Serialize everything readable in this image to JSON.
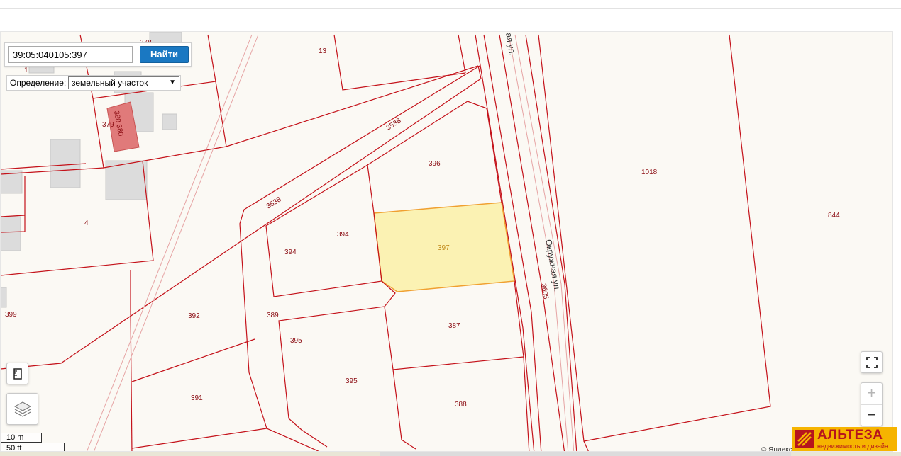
{
  "search": {
    "value": "39:05:040105:397",
    "button_label": "Найти"
  },
  "definition": {
    "label": "Определение:",
    "selected": "земельный участок"
  },
  "parcel_labels": {
    "p378": "378",
    "p13": "13",
    "p1": "1",
    "p379": "379",
    "p380": "380 380",
    "p3538a": "3538",
    "p3538b": "3538",
    "p396": "396",
    "p1018": "1018",
    "p844": "844",
    "p4": "4",
    "p394a": "394",
    "p394b": "394",
    "p397": "397",
    "p399": "399",
    "p392": "392",
    "p389": "389",
    "p387": "387",
    "p395a": "395",
    "p395b": "395",
    "p391": "391",
    "p388": "388",
    "p3605": "3605"
  },
  "streets": {
    "top": "ая ул.",
    "main": "Окружная ул."
  },
  "scale": {
    "metric": "10 m",
    "imperial": "50 ft"
  },
  "copyright": "© Яндекс",
  "brand": {
    "name": "АЛЬТЕЗА",
    "tagline": "недвижимость и дизайн"
  },
  "colors": {
    "boundary": "#c4121a",
    "selected_fill": "#fbf2b3",
    "selected_stroke": "#f0a030",
    "building": "#dcdcdc",
    "highlight_building": "#e07a7a",
    "accent_button": "#1a78c2",
    "brand": "#f6b400"
  }
}
